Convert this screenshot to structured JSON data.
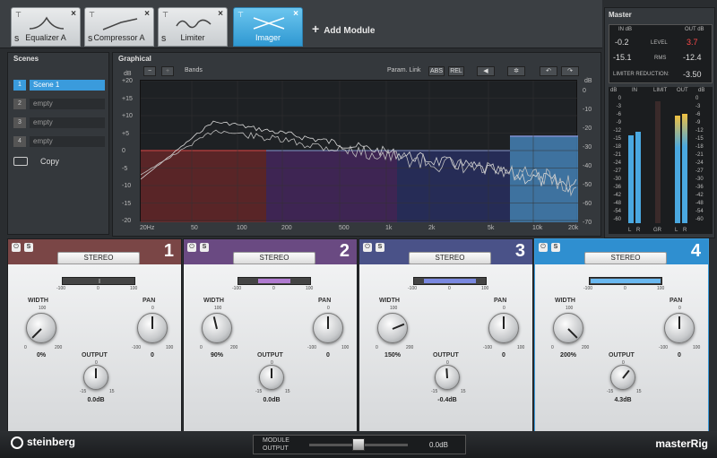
{
  "modules": [
    {
      "label": "Equalizer A",
      "s": "S",
      "close": "×",
      "icon": "eq-curve-icon"
    },
    {
      "label": "Compressor A",
      "s": "S",
      "close": "×",
      "icon": "compressor-curve-icon"
    },
    {
      "label": "Limiter",
      "s": "S",
      "close": "×",
      "icon": "limiter-wave-icon"
    },
    {
      "label": "Imager",
      "s": "S",
      "close": "×",
      "icon": "imager-icon"
    }
  ],
  "add_module": "Add Module",
  "master": {
    "title": "Master",
    "in_db": "IN dB",
    "out_db": "OUT dB",
    "level_label": "LEVEL",
    "rms_label": "RMS",
    "in_level": "-0.2",
    "out_level": "3.7",
    "in_rms": "-15.1",
    "out_rms": "-12.4",
    "limiter_reduction_label": "LIMITER REDUCTION:",
    "limiter_reduction": "-3.50",
    "meter_header": {
      "db": "dB",
      "in": "IN",
      "limit": "LIMIT",
      "out": "OUT",
      "db2": "dB"
    },
    "meter_scale": [
      "0",
      "-3",
      "-6",
      "-9",
      "-12",
      "-15",
      "-18",
      "-21",
      "-24",
      "-27",
      "-30",
      "-36",
      "-42",
      "-48",
      "-54",
      "-60"
    ],
    "meter_scale_right": [
      "0",
      "-3",
      "-6",
      "-9",
      "-12",
      "-15",
      "-18",
      "-21",
      "-24",
      "-27",
      "-30",
      "-36",
      "-42",
      "-48",
      "-54",
      "-60"
    ],
    "meter_footer": {
      "l1": "L",
      "r1": "R",
      "gr": "GR",
      "l2": "L",
      "r2": "R"
    },
    "colors": {
      "in_meter": "#4aa8e0",
      "out_meter": "#e8a23a",
      "out_meter_top": "#f0c040"
    },
    "meter_levels": {
      "in_l": 0.72,
      "in_r": 0.75,
      "out_l": 0.88,
      "out_r": 0.9
    }
  },
  "scenes": {
    "title": "Scenes",
    "items": [
      {
        "num": "1",
        "name": "Scene 1",
        "active": true
      },
      {
        "num": "2",
        "name": "empty",
        "active": false
      },
      {
        "num": "3",
        "name": "empty",
        "active": false
      },
      {
        "num": "4",
        "name": "empty",
        "active": false
      }
    ],
    "copy_label": "Copy"
  },
  "graphical": {
    "title": "Graphical",
    "minus": "−",
    "plus": "+",
    "bands_label": "Bands",
    "param_link": "Param. Link",
    "abs": "ABS",
    "rel": "REL",
    "left_axis_unit": "dB",
    "right_axis_unit": "dB",
    "left_ticks": [
      "+20",
      "+15",
      "+10",
      "+5",
      "0",
      "-5",
      "-10",
      "-15",
      "-20"
    ],
    "right_ticks": [
      "0",
      "-10",
      "-20",
      "-30",
      "-40",
      "-50",
      "-60",
      "-70"
    ],
    "freq_ticks": [
      "20Hz",
      "50",
      "100",
      "200",
      "500",
      "1k",
      "2k",
      "5k",
      "10k",
      "20k"
    ],
    "band_colors": [
      "#8b2a2a",
      "#5a2a7a",
      "#2e3680",
      "#4a8ec8"
    ]
  },
  "bands": [
    {
      "num": "1",
      "stereo": "STEREO",
      "width_label": "WIDTH",
      "pan_label": "PAN",
      "output_label": "OUTPUT",
      "width_value": "0%",
      "pan_value": "0",
      "output_value": "0.0dB",
      "width_min": "0",
      "width_mid": "100",
      "width_max": "200",
      "pan_min": "-100",
      "pan_mid": "0",
      "pan_max": "100",
      "out_min": "-15",
      "out_mid": "0",
      "out_max": "15",
      "bar_min": "-100",
      "bar_mid": "0",
      "bar_max": "100",
      "header_color": "#7a4646",
      "bar_fill_color": "#7a7a7a",
      "bar_fill_width": 0.0,
      "width_level": 0.0,
      "pan_level": 0.5,
      "output_level": 0.5,
      "power": "⏻",
      "solo": "S"
    },
    {
      "num": "2",
      "stereo": "STEREO",
      "width_label": "WIDTH",
      "pan_label": "PAN",
      "output_label": "OUTPUT",
      "width_value": "90%",
      "pan_value": "0",
      "output_value": "0.0dB",
      "width_min": "0",
      "width_mid": "100",
      "width_max": "200",
      "pan_min": "-100",
      "pan_mid": "0",
      "pan_max": "100",
      "out_min": "-15",
      "out_mid": "0",
      "out_max": "15",
      "bar_min": "-100",
      "bar_mid": "0",
      "bar_max": "100",
      "header_color": "#6a4a82",
      "bar_fill_color": "#b07ad0",
      "bar_fill_width": 0.45,
      "width_level": 0.45,
      "pan_level": 0.5,
      "output_level": 0.5,
      "power": "⏻",
      "solo": "S"
    },
    {
      "num": "3",
      "stereo": "STEREO",
      "width_label": "WIDTH",
      "pan_label": "PAN",
      "output_label": "OUTPUT",
      "width_value": "150%",
      "pan_value": "0",
      "output_value": "-0.4dB",
      "width_min": "0",
      "width_mid": "100",
      "width_max": "200",
      "pan_min": "-100",
      "pan_mid": "0",
      "pan_max": "100",
      "out_min": "-15",
      "out_mid": "0",
      "out_max": "15",
      "bar_min": "-100",
      "bar_mid": "0",
      "bar_max": "100",
      "header_color": "#4a5288",
      "bar_fill_color": "#7a88e0",
      "bar_fill_width": 0.75,
      "width_level": 0.75,
      "pan_level": 0.5,
      "output_level": 0.487,
      "power": "⏻",
      "solo": "S"
    },
    {
      "num": "4",
      "stereo": "STEREO",
      "width_label": "WIDTH",
      "pan_label": "PAN",
      "output_label": "OUTPUT",
      "width_value": "200%",
      "pan_value": "0",
      "output_value": "4.3dB",
      "width_min": "0",
      "width_mid": "100",
      "width_max": "200",
      "pan_min": "-100",
      "pan_mid": "0",
      "pan_max": "100",
      "out_min": "-15",
      "out_mid": "0",
      "out_max": "15",
      "bar_min": "-100",
      "bar_mid": "0",
      "bar_max": "100",
      "header_color": "#2f8fd0",
      "bar_fill_color": "#6ab8f0",
      "bar_fill_width": 1.0,
      "width_level": 1.0,
      "pan_level": 0.5,
      "output_level": 0.643,
      "power": "⏻",
      "solo": "S"
    }
  ],
  "module_output": {
    "label1": "MODULE",
    "label2": "OUTPUT",
    "value": "0.0dB"
  },
  "logo": "steinberg",
  "brand": "masterRig"
}
